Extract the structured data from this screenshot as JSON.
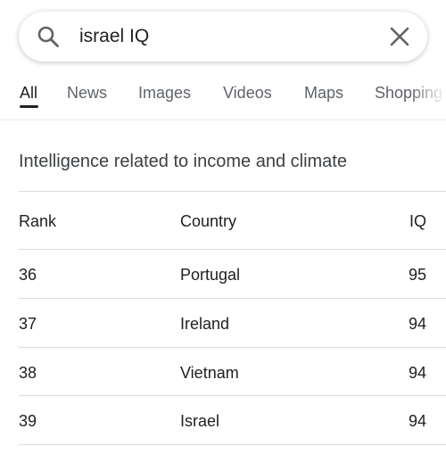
{
  "search": {
    "query": "israel IQ",
    "search_icon": "search-icon",
    "clear_icon": "close-icon"
  },
  "tabs": [
    {
      "label": "All",
      "active": true
    },
    {
      "label": "News",
      "active": false
    },
    {
      "label": "Images",
      "active": false
    },
    {
      "label": "Videos",
      "active": false
    },
    {
      "label": "Maps",
      "active": false
    },
    {
      "label": "Shopping",
      "active": false
    }
  ],
  "card": {
    "title": "Intelligence related to income and climate",
    "headers": {
      "rank": "Rank",
      "country": "Country",
      "iq": "IQ"
    },
    "rows": [
      {
        "rank": "36",
        "country": "Portugal",
        "iq": "95"
      },
      {
        "rank": "37",
        "country": "Ireland",
        "iq": "94"
      },
      {
        "rank": "38",
        "country": "Vietnam",
        "iq": "94"
      },
      {
        "rank": "39",
        "country": "Israel",
        "iq": "94"
      }
    ]
  },
  "colors": {
    "text": "#202124",
    "tab_inactive": "#5f6368",
    "divider": "#dadce0"
  }
}
